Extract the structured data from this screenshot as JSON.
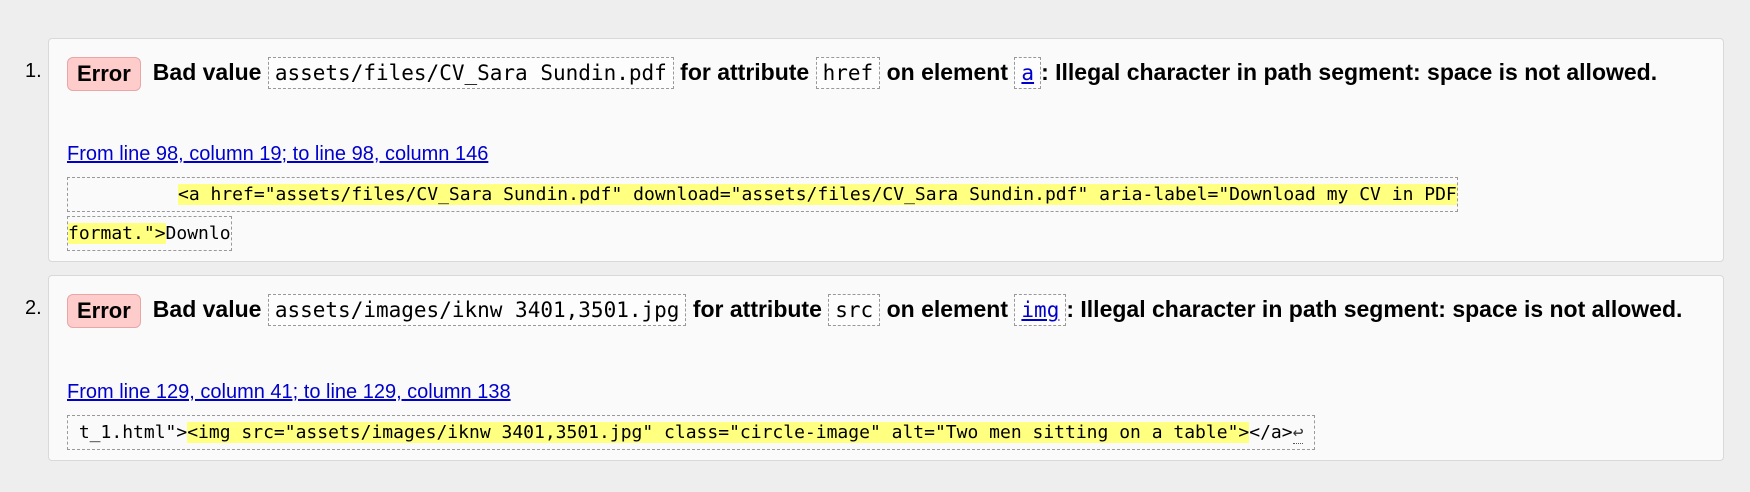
{
  "messages": [
    {
      "number": "1.",
      "badge": "Error",
      "text_bad_value": "Bad value",
      "value": "assets/files/CV_Sara Sundin.pdf",
      "text_for_attribute": "for attribute",
      "attribute": "href",
      "text_on_element": "on element",
      "element": "a",
      "reason": ": Illegal character in path segment: space is not allowed.",
      "location": "From line 98, column 19; to line 98, column 146",
      "extract_before": "",
      "extract_highlight": "<a href=\"assets/files/CV_Sara Sundin.pdf\" download=\"assets/files/CV_Sara Sundin.pdf\" aria-label=\"Download my CV in PDF format.\">",
      "extract_after": "Downlo"
    },
    {
      "number": "2.",
      "badge": "Error",
      "text_bad_value": "Bad value",
      "value": "assets/images/iknw 3401,3501.jpg",
      "text_for_attribute": "for attribute",
      "attribute": "src",
      "text_on_element": "on element",
      "element": "img",
      "reason": ": Illegal character in path segment: space is not allowed.",
      "location": "From line 129, column 41; to line 129, column 138",
      "extract_before": "t_1.html\">",
      "extract_highlight": "<img src=\"assets/images/iknw 3401,3501.jpg\" class=\"circle-image\" alt=\"Two men sitting on a table\">",
      "extract_after": "</a>",
      "return_glyph": "↩"
    }
  ],
  "colors": {
    "error_badge_bg": "#ffcccc",
    "highlight_bg": "#ffff80",
    "link": "#0000cc"
  }
}
